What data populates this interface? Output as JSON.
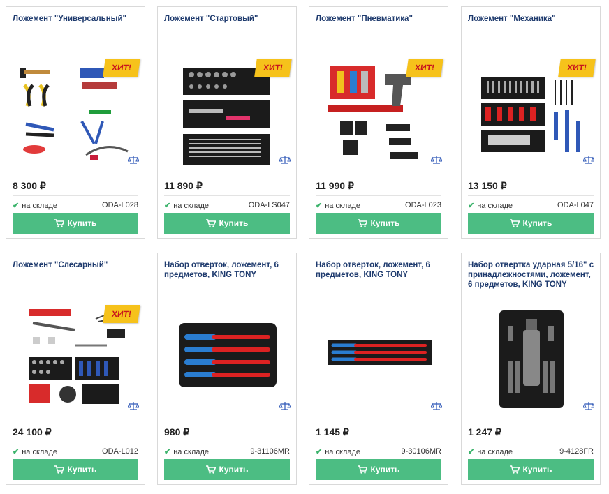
{
  "badge_label": "ХИТ!",
  "stock_check": "✔",
  "buy_icon": "cart-icon",
  "colors": {
    "accent_green": "#4cbd83",
    "title_blue": "#1f3b6e",
    "hit_yellow": "#f6c21b",
    "hit_red": "#c8141d"
  },
  "products": [
    {
      "title": "Ложемент \"Универсальный\"",
      "price": "8 300 ₽",
      "stock": "на складе",
      "sku": "ODA-L028",
      "buy": "Купить",
      "hit": true
    },
    {
      "title": "Ложемент \"Стартовый\"",
      "price": "11 890 ₽",
      "stock": "на складе",
      "sku": "ODA-LS047",
      "buy": "Купить",
      "hit": true
    },
    {
      "title": "Ложемент \"Пневматика\"",
      "price": "11 990 ₽",
      "stock": "на складе",
      "sku": "ODA-L023",
      "buy": "Купить",
      "hit": true
    },
    {
      "title": "Ложемент \"Механика\"",
      "price": "13 150 ₽",
      "stock": "на складе",
      "sku": "ODA-L047",
      "buy": "Купить",
      "hit": true
    },
    {
      "title": "Ложемент \"Слесарный\"",
      "price": "24 100 ₽",
      "stock": "на складе",
      "sku": "ODA-L012",
      "buy": "Купить",
      "hit": true
    },
    {
      "title": "Набор отверток, ложемент, 6 предметов, KING TONY",
      "price": "980 ₽",
      "stock": "на складе",
      "sku": "9-31106MR",
      "buy": "Купить",
      "hit": false
    },
    {
      "title": "Набор отверток, ложемент, 6 предметов, KING TONY",
      "price": "1 145 ₽",
      "stock": "на складе",
      "sku": "9-30106MR",
      "buy": "Купить",
      "hit": false
    },
    {
      "title": "Набор отвертка ударная 5/16\" с принадлежностями, ложемент, 6 предметов, KING TONY",
      "price": "1 247 ₽",
      "stock": "на складе",
      "sku": "9-4128FR",
      "buy": "Купить",
      "hit": false
    }
  ]
}
